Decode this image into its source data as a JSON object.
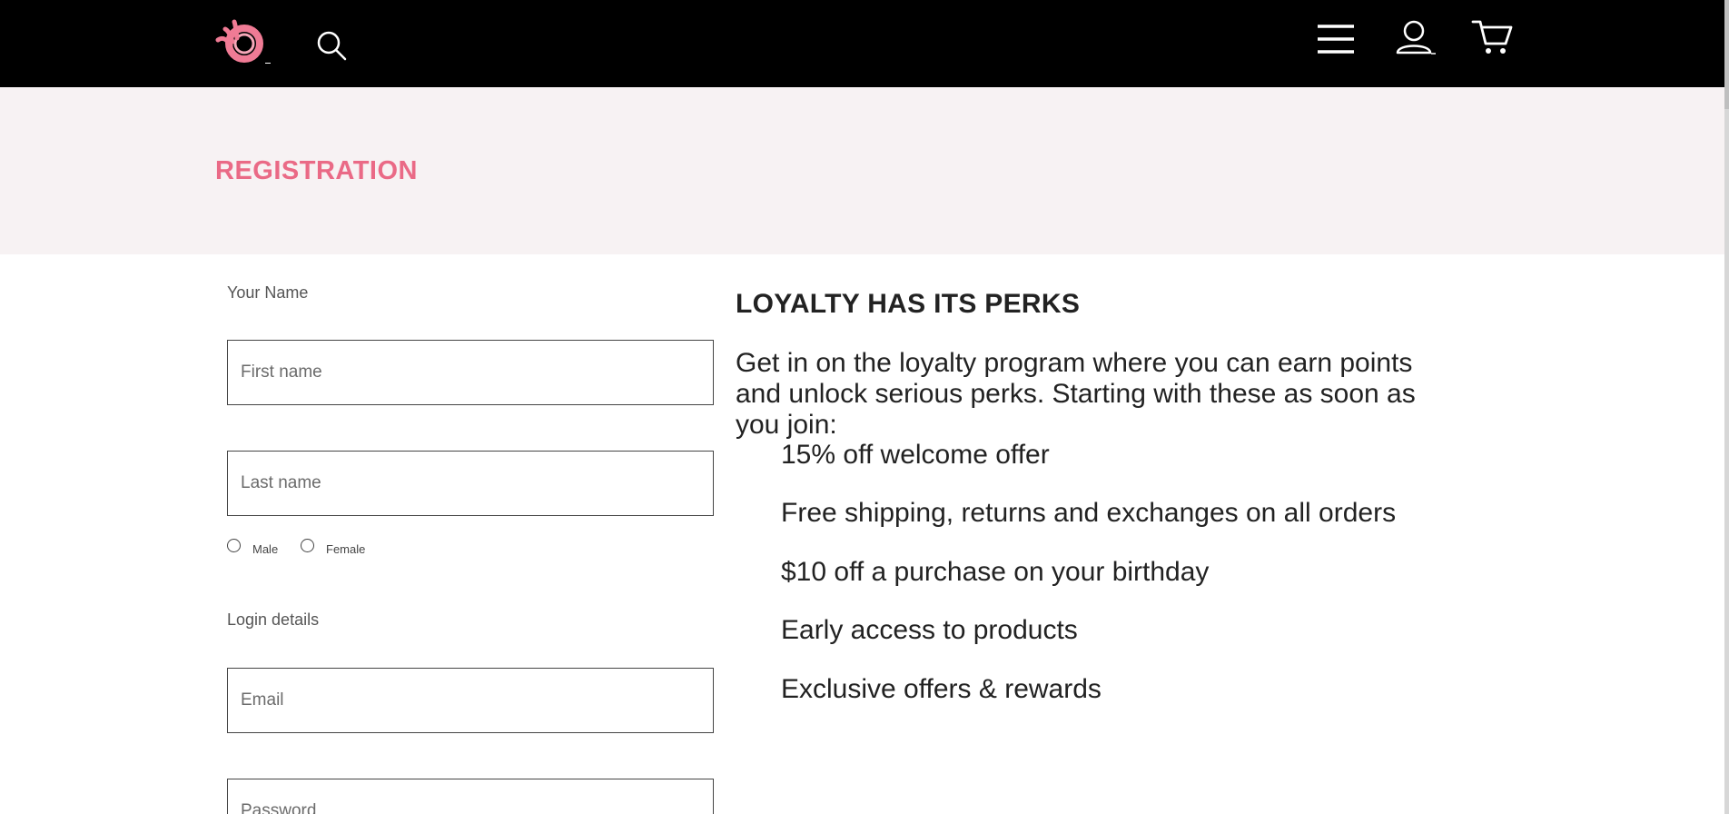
{
  "header": {
    "logo": "brand-logo",
    "icons": [
      "search-icon",
      "menu-icon",
      "account-icon",
      "cart-icon"
    ],
    "background": "#000000"
  },
  "page": {
    "title": "REGISTRATION",
    "title_color": "#ea6a86",
    "band_color": "#f7f2f3"
  },
  "form": {
    "name_section_label": "Your Name",
    "first_name": {
      "placeholder": "First name",
      "value": ""
    },
    "last_name": {
      "placeholder": "Last name",
      "value": ""
    },
    "gender_options": [
      "Male",
      "Female"
    ],
    "login_section_label": "Login details",
    "email": {
      "placeholder": "Email",
      "value": ""
    },
    "password": {
      "placeholder": "Password",
      "value": ""
    }
  },
  "perks": {
    "heading": "LOYALTY HAS ITS PERKS",
    "intro": "Get in on the loyalty program where you can earn points and unlock serious perks. Starting with these as soon as you join:",
    "items": [
      "15% off welcome offer",
      "Free shipping, returns and exchanges on all orders",
      "$10 off a purchase on your birthday",
      "Early access to products",
      "Exclusive offers & rewards"
    ]
  }
}
